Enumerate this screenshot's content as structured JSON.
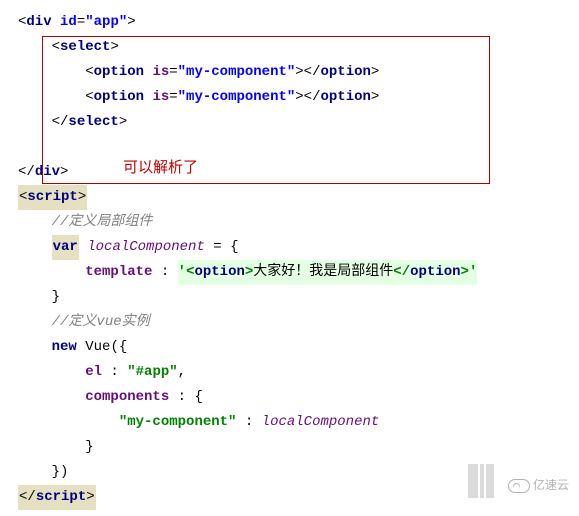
{
  "code": {
    "l1": {
      "p1": "<",
      "tag1": "div ",
      "attr": "id",
      "eq": "=",
      "val": "\"app\"",
      "p2": ">"
    },
    "l2": {
      "ind": "    ",
      "p1": "<",
      "tag": "select",
      "p2": ">"
    },
    "l3": {
      "ind": "        ",
      "p1": "<",
      "tag1": "option ",
      "iskw": "is",
      "eq": "=",
      "val": "\"my-component\"",
      "p2": "></",
      "tag2": "option",
      "p3": ">"
    },
    "l4": {
      "ind": "        ",
      "p1": "<",
      "tag1": "option ",
      "iskw": "is",
      "eq": "=",
      "val": "\"my-component\"",
      "p2": "></",
      "tag2": "option",
      "p3": ">"
    },
    "l5": {
      "ind": "    ",
      "p1": "</",
      "tag": "select",
      "p2": ">"
    },
    "blank": " ",
    "l6": {
      "p1": "</",
      "tag": "div",
      "p2": ">"
    },
    "l7": {
      "p1": "<",
      "tag": "script",
      "p2": ">"
    },
    "l8": {
      "ind": "    ",
      "cm": "//定义局部组件"
    },
    "l9": {
      "ind": "    ",
      "kw": "var",
      "sp": " ",
      "var": "localComponent",
      "rest": " = {"
    },
    "l10": {
      "ind": "        ",
      "field": "template",
      "sp": " : ",
      "q1": "'",
      "lt": "<",
      "otag": "option",
      "gt": ">",
      "txt": "大家好！我是局部组件",
      "lt2": "</",
      "ctag": "option",
      "gt2": ">",
      "q2": "'"
    },
    "l11": {
      "ind": "    ",
      "brace": "}"
    },
    "l12": {
      "ind": "    ",
      "cm": "//定义vue实例"
    },
    "l13": {
      "ind": "    ",
      "kw": "new",
      "sp": " ",
      "txt": "Vue({"
    },
    "l14": {
      "ind": "        ",
      "field": "el",
      "sp": " : ",
      "val": "\"#app\"",
      "comma": ","
    },
    "l15": {
      "ind": "        ",
      "field": "components",
      "rest": " : {"
    },
    "l16": {
      "ind": "            ",
      "key": "\"my-component\"",
      "sp": " : ",
      "var": "localComponent"
    },
    "l17": {
      "ind": "        ",
      "brace": "}"
    },
    "l18": {
      "ind": "    ",
      "brace": "})"
    },
    "l19": {
      "p1": "</",
      "tag": "script",
      "p2": ">"
    }
  },
  "annotation": "可以解析了",
  "watermark": "亿速云"
}
